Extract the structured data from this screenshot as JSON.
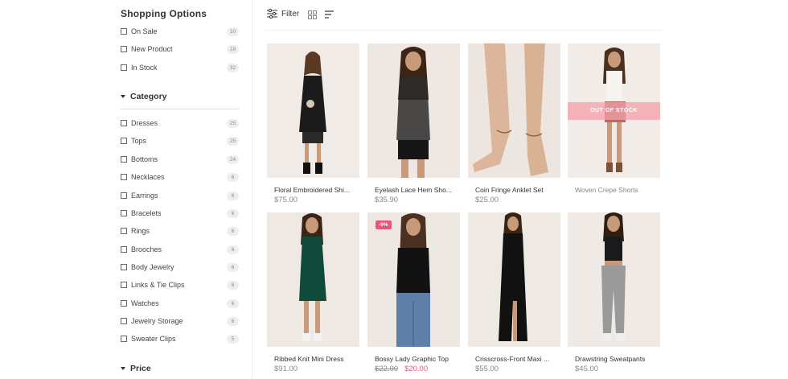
{
  "sidebar": {
    "title": "Shopping Options",
    "options": [
      {
        "label": "On Sale",
        "count": "10"
      },
      {
        "label": "New Product",
        "count": "18"
      },
      {
        "label": "In Stock",
        "count": "32"
      }
    ],
    "category_heading": "Category",
    "categories": [
      {
        "label": "Dresses",
        "count": "25"
      },
      {
        "label": "Tops",
        "count": "25"
      },
      {
        "label": "Bottoms",
        "count": "24"
      },
      {
        "label": "Necklaces",
        "count": "6"
      },
      {
        "label": "Earrings",
        "count": "6"
      },
      {
        "label": "Bracelets",
        "count": "6"
      },
      {
        "label": "Rings",
        "count": "6"
      },
      {
        "label": "Brooches",
        "count": "6"
      },
      {
        "label": "Body Jewelry",
        "count": "6"
      },
      {
        "label": "Links & Tie Clips",
        "count": "6"
      },
      {
        "label": "Watches",
        "count": "6"
      },
      {
        "label": "Jewelry Storage",
        "count": "6"
      },
      {
        "label": "Sweater Clips",
        "count": "5"
      }
    ],
    "price_heading": "Price"
  },
  "toolbar": {
    "filter_label": "Filter",
    "icons": [
      "filter-sliders-icon",
      "grid-view-icon",
      "list-view-icon"
    ],
    "accent_color": "#e6557a"
  },
  "products": [
    {
      "name": "Floral Embroidered Shi...",
      "price": "$75.00"
    },
    {
      "name": "Eyelash Lace Hem Sho...",
      "price": "$35.90"
    },
    {
      "name": "Coin Fringe Anklet Set",
      "price": "$25.00"
    },
    {
      "name": "Woven Crepe Shorts",
      "price": "",
      "overlay": "OUT OF STOCK"
    },
    {
      "name": "Ribbed Knit Mini Dress",
      "price": "$91.00"
    },
    {
      "name": "Bossy Lady Graphic Top",
      "old_price": "$22.00",
      "price": "$20.00",
      "badge": "-9%"
    },
    {
      "name": "Crisscross-Front Maxi ...",
      "price": "$55.00"
    },
    {
      "name": "Drawstring Sweatpants",
      "price": "$45.00"
    }
  ]
}
